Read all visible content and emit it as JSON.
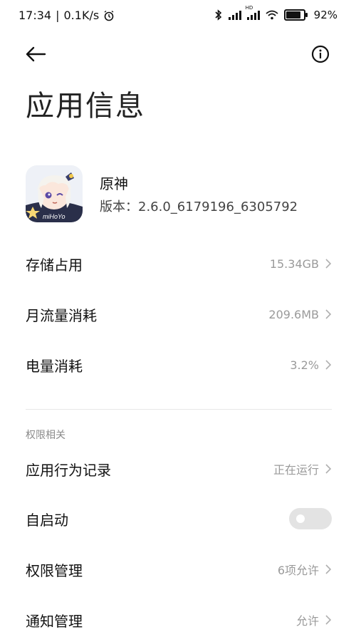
{
  "status_bar": {
    "time": "17:34",
    "net_speed": "0.1K/s",
    "battery": "92%",
    "signal_label": "HD"
  },
  "header": {
    "title": "应用信息"
  },
  "app": {
    "name": "原神",
    "version": "版本：2.6.0_6179196_6305792",
    "icon_text": "miHoYo"
  },
  "rows": [
    {
      "label": "存储占用",
      "value": "15.34GB"
    },
    {
      "label": "月流量消耗",
      "value": "209.6MB"
    },
    {
      "label": "电量消耗",
      "value": "3.2%"
    }
  ],
  "permissions": {
    "section_label": "权限相关",
    "items": [
      {
        "label": "应用行为记录",
        "value": "正在运行"
      },
      {
        "label": "自启动",
        "toggle": false
      },
      {
        "label": "权限管理",
        "value": "6项允许"
      },
      {
        "label": "通知管理",
        "value": "允许"
      }
    ]
  },
  "colors": {
    "text_primary": "#111111",
    "text_secondary": "#9a9a9a",
    "toggle_off": "#e3e3e3"
  }
}
